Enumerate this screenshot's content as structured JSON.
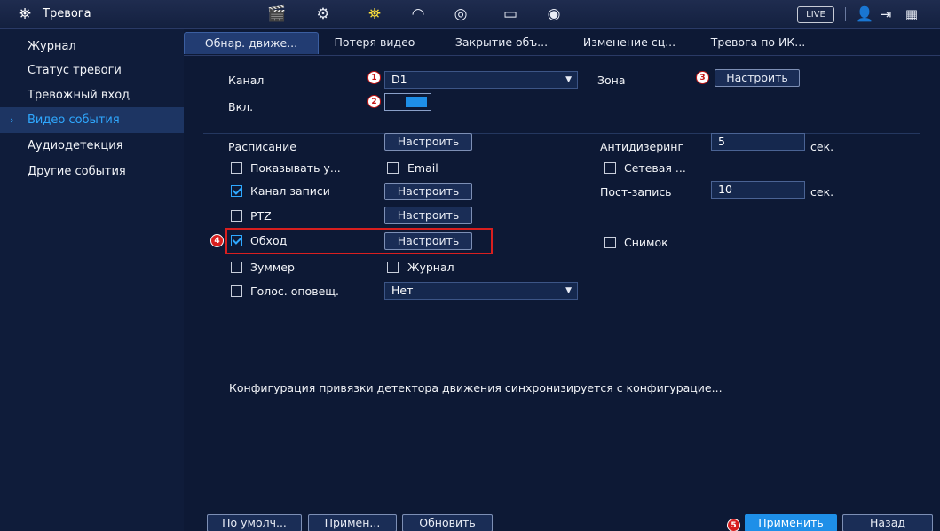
{
  "header": {
    "title": "Тревога",
    "title_icon": "alarm-light-icon",
    "toolbar_icons": [
      "camera-film-icon",
      "gear-globe-icon",
      "alarm-light-icon",
      "speedometer-icon",
      "target-icon",
      "monitor-icon",
      "speaker-icon"
    ],
    "live_label": "LIVE",
    "right_icons": [
      "user-icon",
      "logout-icon",
      "qr-code-icon"
    ],
    "accent_color": "#ffe23a"
  },
  "sidebar": {
    "items": [
      {
        "label": "Журнал"
      },
      {
        "label": "Статус тревоги"
      },
      {
        "label": "Тревожный вход"
      },
      {
        "label": "Видео события"
      },
      {
        "label": "Аудиодетекция"
      },
      {
        "label": "Другие события"
      }
    ],
    "active_index": 3,
    "active_color": "#2fa8ff"
  },
  "tabs": [
    {
      "label": "Обнар. движе..."
    },
    {
      "label": "Потеря видео"
    },
    {
      "label": "Закрытие объ..."
    },
    {
      "label": "Изменение сц..."
    },
    {
      "label": "Тревога по ИК..."
    }
  ],
  "form": {
    "channel_label": "Канал",
    "channel_value": "D1",
    "zone_label": "Зона",
    "zone_button": "Настроить",
    "enable_label": "Вкл.",
    "enable_on": true,
    "schedule_label": "Расписание",
    "schedule_button": "Настроить",
    "antidither_label": "Антидизеринг",
    "antidither_value": "5",
    "antidither_unit": "сек.",
    "show_msg_label": "Показывать у...",
    "email_label": "Email",
    "network_label": "Сетевая ...",
    "record_channel_label": "Канал записи",
    "record_channel_button": "Настроить",
    "post_record_label": "Пост-запись",
    "post_record_value": "10",
    "post_record_unit": "сек.",
    "ptz_label": "PTZ",
    "ptz_button": "Настроить",
    "tour_label": "Обход",
    "tour_button": "Настроить",
    "snapshot_label": "Снимок",
    "buzzer_label": "Зуммер",
    "log_label": "Журнал",
    "voice_label": "Голос. оповещ.",
    "voice_value": "Нет",
    "note": "Конфигурация привязки детектора движения синхронизируется с конфигурацие..."
  },
  "checkboxes": {
    "show_msg": false,
    "email": false,
    "network": false,
    "record_channel": true,
    "ptz": false,
    "tour": true,
    "snapshot": false,
    "buzzer": false,
    "log": false,
    "voice": false
  },
  "markers": [
    "1",
    "2",
    "3",
    "4",
    "5"
  ],
  "footer": {
    "default_label": "По умолч...",
    "apply_small_label": "Примен...",
    "refresh_label": "Обновить",
    "apply_label": "Применить",
    "back_label": "Назад"
  }
}
